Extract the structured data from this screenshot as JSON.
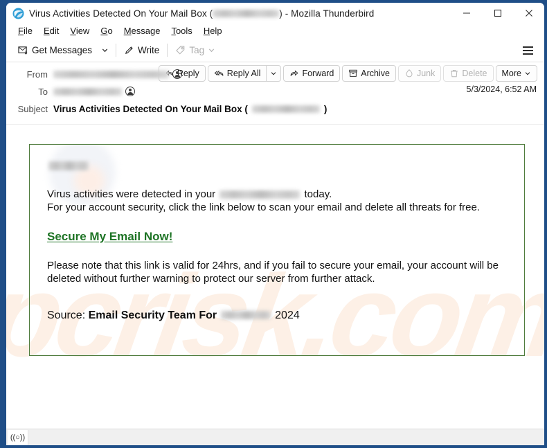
{
  "window": {
    "title_prefix": "Virus Activities Detected On Your Mail Box (",
    "title_suffix": ") - Mozilla Thunderbird",
    "app_name": "Mozilla Thunderbird",
    "minimize_label": "—",
    "maximize_label": "☐",
    "close_label": "✕",
    "frame_color": "#1f4e87"
  },
  "menubar": {
    "items": [
      {
        "key": "F",
        "rest": "ile"
      },
      {
        "key": "E",
        "rest": "dit"
      },
      {
        "key": "V",
        "rest": "iew"
      },
      {
        "key": "G",
        "rest": "o"
      },
      {
        "key": "M",
        "rest": "essage"
      },
      {
        "key": "T",
        "rest": "ools"
      },
      {
        "key": "H",
        "rest": "elp"
      }
    ]
  },
  "toolbar": {
    "get_messages_label": "Get Messages",
    "get_messages_caret": "⌄",
    "write_label": "Write",
    "tag_label": "Tag",
    "tag_caret": "⌄",
    "hamburger_name": "app-menu"
  },
  "message_actions": {
    "reply": "Reply",
    "reply_all": "Reply All",
    "reply_all_caret": "⌄",
    "forward": "Forward",
    "archive": "Archive",
    "junk": "Junk",
    "delete": "Delete",
    "more": "More",
    "more_caret": "⌄"
  },
  "headers": {
    "from_label": "From",
    "to_label": "To",
    "subject_label": "Subject",
    "from_value_redacted": true,
    "to_value_redacted": true,
    "subject_prefix": "Virus Activities Detected On Your Mail Box (",
    "subject_suffix": ")",
    "date": "5/3/2024, 6:52 AM"
  },
  "body": {
    "greeting_redacted": true,
    "line1_before": "Virus activities were detected in your",
    "line1_after": "today.",
    "line2": "For your account security, click the link below to scan your email and delete all threats for free.",
    "link_text": "Secure My Email Now!",
    "paragraph2": "Please note that this link is valid for 24hrs, and if you fail to secure your email, your account will be deleted without further warning to protect our server from further attack.",
    "source_label": "Source:",
    "source_team": "Email Security Team For",
    "source_year": "2024",
    "link_color": "#1d7324",
    "border_color": "#4f7c3d"
  },
  "watermark": {
    "text": "pcrisk.com",
    "color": "#fdf0e6"
  },
  "statusbar": {
    "connection_icon": "((○))"
  }
}
